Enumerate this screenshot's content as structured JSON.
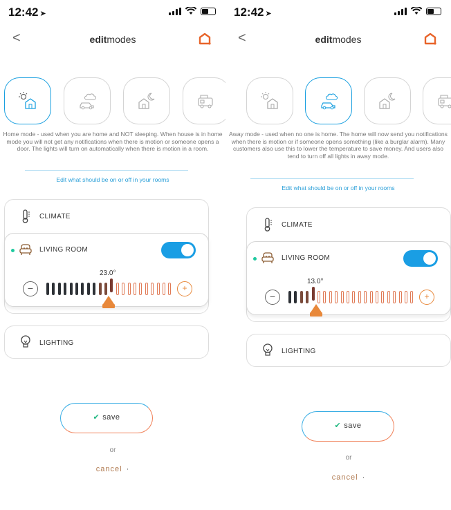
{
  "status": {
    "time": "12:42"
  },
  "nav": {
    "title_bold": "edit",
    "title_rest": "modes",
    "back_glyph": "<"
  },
  "modes": [
    {
      "name": "home",
      "icon": "sun-house-icon"
    },
    {
      "name": "away",
      "icon": "cloud-car-icon"
    },
    {
      "name": "night",
      "icon": "moon-house-icon"
    },
    {
      "name": "vacation",
      "icon": "camper-icon"
    }
  ],
  "screens": [
    {
      "active_mode": "home",
      "description": "Home mode - used when you are home and NOT sleeping. When house is in home mode you will not get any notifications when there is motion or someone opens a door. The lights will turn on automatically when there is motion in a room.",
      "temperature": "23.0°",
      "filled_ticks": 12
    },
    {
      "active_mode": "away",
      "description": "Away mode - used when no one is home. The home will now send you notifications when there is motion or if someone opens something (like a burglar alarm). Many customers also use this to lower the temperature to save money. And users also tend to turn off all lights in away mode.",
      "temperature": "13.0°",
      "filled_ticks": 5
    }
  ],
  "edit_link": "Edit what should be on or off in your rooms",
  "rows": {
    "climate": "CLIMATE",
    "living_room": "LIVING ROOM",
    "lighting": "LIGHTING"
  },
  "controls": {
    "minus": "−",
    "plus": "+"
  },
  "actions": {
    "save": "save",
    "save_check": "✔",
    "or": "or",
    "cancel": "cancel",
    "cancel_dot": "·"
  },
  "colors": {
    "accent_blue": "#1a9ee4",
    "accent_orange": "#e8883a",
    "status_green": "#1ec99f"
  }
}
